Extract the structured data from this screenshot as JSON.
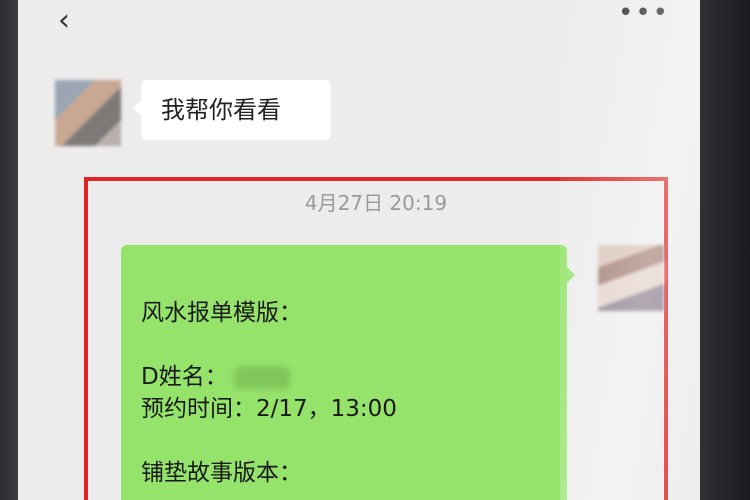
{
  "nav": {
    "back_icon": "‹",
    "more_icon": "•••"
  },
  "messages": [
    {
      "sender": "other",
      "text": "我帮你看看"
    }
  ],
  "timestamp": "4月27日 20:19",
  "template_message": {
    "title": "风水报单模版：",
    "name_label": "D姓名：",
    "appointment_label": "预约时间：",
    "appointment_value": "2/17，13:00",
    "story_label": "铺垫故事版本："
  },
  "colors": {
    "bubble_self": "#95e36b",
    "bubble_other": "#ffffff",
    "highlight": "#e02424",
    "chat_bg": "#ececec"
  }
}
